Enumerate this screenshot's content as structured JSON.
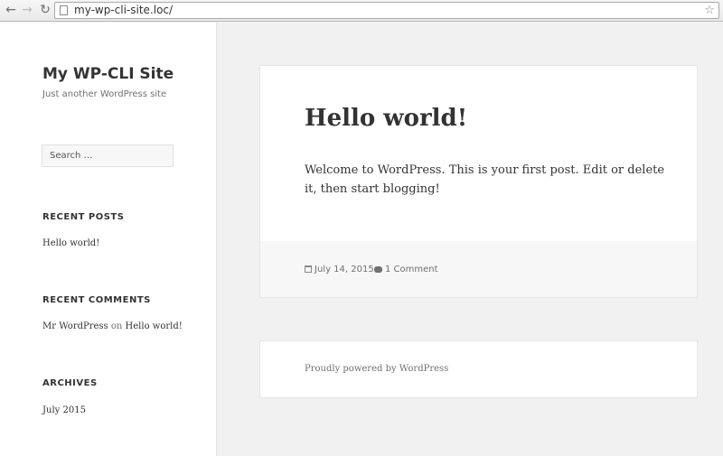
{
  "browser": {
    "url": "my-wp-cli-site.loc/",
    "icons": {
      "back": "back-arrow-icon",
      "forward": "forward-arrow-icon",
      "reload": "reload-icon",
      "page": "page-icon",
      "bookmark": "star-icon"
    }
  },
  "sidebar": {
    "site_title": "My WP-CLI Site",
    "site_description": "Just another WordPress site",
    "search_placeholder": "Search …",
    "recent_posts": {
      "title": "Recent Posts",
      "items": [
        "Hello world!"
      ]
    },
    "recent_comments": {
      "title": "Recent Comments",
      "author": "Mr WordPress",
      "connector": "on",
      "post": "Hello world!"
    },
    "archives": {
      "title": "Archives",
      "items": [
        "July 2015"
      ]
    }
  },
  "post": {
    "title": "Hello world!",
    "body": "Welcome to WordPress. This is your first post. Edit or delete it, then start blogging!",
    "date": "July 14, 2015",
    "comments": "1 Comment"
  },
  "footer": {
    "powered_by": "Proudly powered by WordPress"
  }
}
